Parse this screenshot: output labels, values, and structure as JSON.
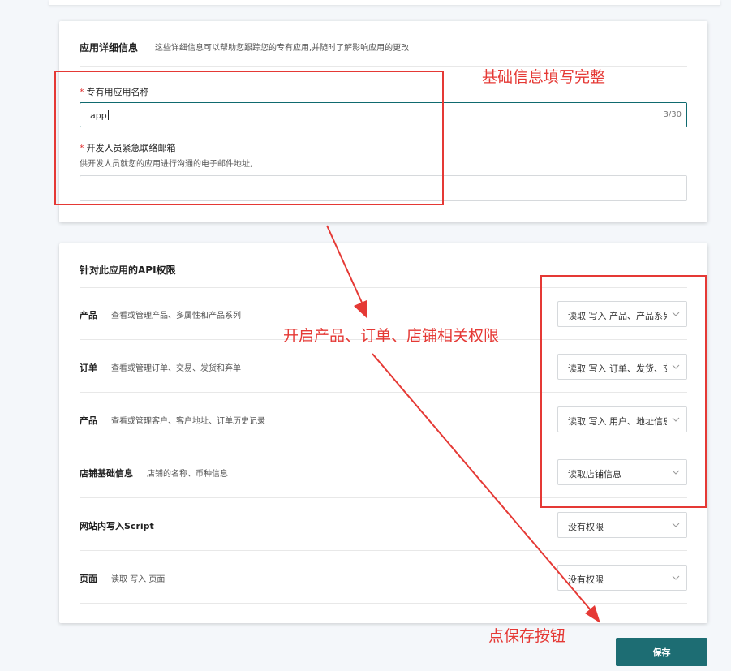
{
  "details": {
    "title": "应用详细信息",
    "description": "这些详细信息可以帮助您跟踪您的专有应用,并随时了解影响应用的更改",
    "required_mark": "*",
    "app_name_label": "专有用应用名称",
    "app_name_value": "app",
    "app_name_count": "3/30",
    "email_label": "开发人员紧急联络邮箱",
    "email_hint": "供开发人员就您的应用进行沟通的电子邮件地址,",
    "email_value": ""
  },
  "permissions": {
    "title": "针对此应用的API权限",
    "rows": [
      {
        "name": "产品",
        "desc": "查看或管理产品、多属性和产品系列",
        "value": "读取 写入 产品、产品系列"
      },
      {
        "name": "订单",
        "desc": "查看或管理订单、交易、发货和弃单",
        "value": "读取 写入 订单、发货、交易"
      },
      {
        "name": "产品",
        "desc": "查看或管理客户、客户地址、订单历史记录",
        "value": "读取 写入 用户、地址信息"
      },
      {
        "name": "店铺基础信息",
        "desc": "店铺的名称、币种信息",
        "value": "读取店铺信息"
      },
      {
        "name": "网站内写入Script",
        "desc": "",
        "value": "没有权限"
      },
      {
        "name": "页面",
        "desc": "读取 写入 页面",
        "value": "没有权限"
      }
    ]
  },
  "save_label": "保存",
  "annotations": {
    "fill_basic": "基础信息填写完整",
    "enable_perms": "开启产品、订单、店铺相关权限",
    "click_save": "点保存按钮"
  },
  "colors": {
    "accent": "#1d6d73",
    "annotation": "#e53935",
    "required": "#e03030"
  }
}
